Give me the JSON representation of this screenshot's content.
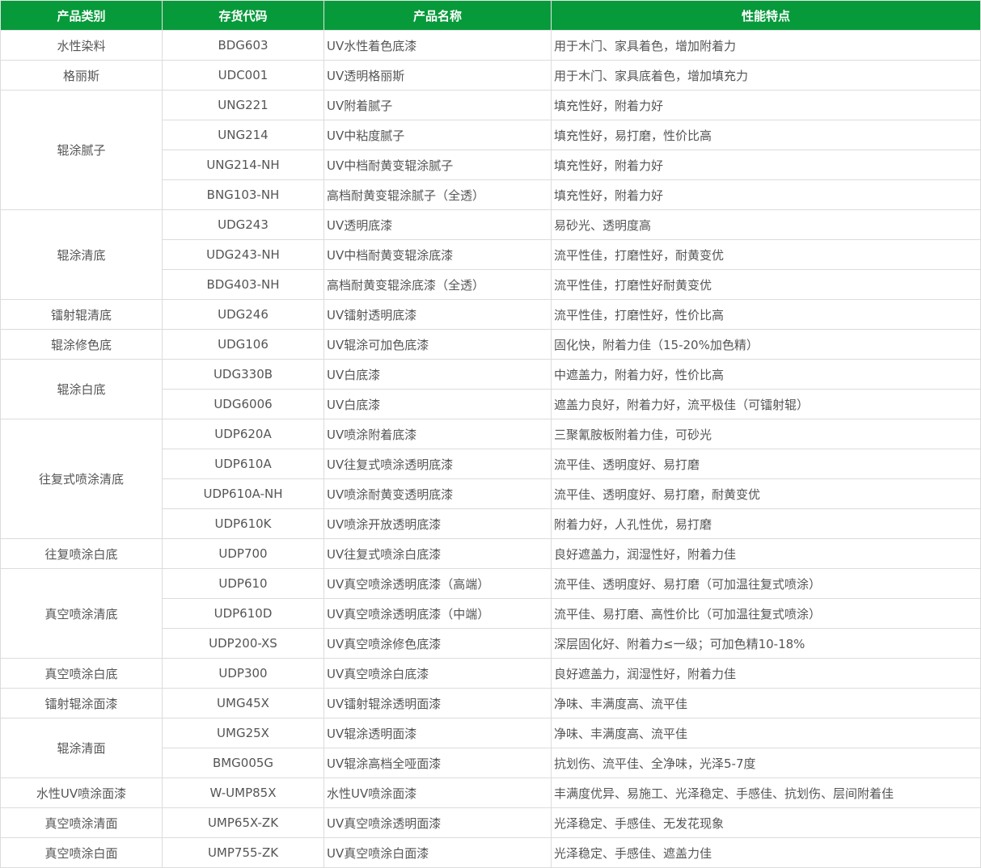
{
  "header": [
    "产品类别",
    "存货代码",
    "产品名称",
    "性能特点"
  ],
  "groups": [
    {
      "category": "水性染料",
      "items": [
        {
          "code": "BDG603",
          "name": "UV水性着色底漆",
          "feature": "用于木门、家具着色，增加附着力"
        }
      ]
    },
    {
      "category": "格丽斯",
      "items": [
        {
          "code": "UDC001",
          "name": "UV透明格丽斯",
          "feature": "用于木门、家具底着色，增加填充力"
        }
      ]
    },
    {
      "category": "辊涂腻子",
      "items": [
        {
          "code": "UNG221",
          "name": "UV附着腻子",
          "feature": "填充性好，附着力好"
        },
        {
          "code": "UNG214",
          "name": "UV中粘度腻子",
          "feature": "填充性好，易打磨，性价比高"
        },
        {
          "code": "UNG214-NH",
          "name": "UV中档耐黄变辊涂腻子",
          "feature": "填充性好，附着力好"
        },
        {
          "code": "BNG103-NH",
          "name": "高档耐黄变辊涂腻子（全透）",
          "feature": "填充性好，附着力好"
        }
      ]
    },
    {
      "category": "辊涂清底",
      "items": [
        {
          "code": "UDG243",
          "name": "UV透明底漆",
          "feature": "易砂光、透明度高"
        },
        {
          "code": "UDG243-NH",
          "name": "UV中档耐黄变辊涂底漆",
          "feature": "流平性佳，打磨性好，耐黄变优"
        },
        {
          "code": "BDG403-NH",
          "name": "高档耐黄变辊涂底漆（全透）",
          "feature": "流平性佳，打磨性好耐黄变优"
        }
      ]
    },
    {
      "category": "镭射辊清底",
      "items": [
        {
          "code": "UDG246",
          "name": "UV镭射透明底漆",
          "feature": "流平性佳，打磨性好，性价比高"
        }
      ]
    },
    {
      "category": "辊涂修色底",
      "items": [
        {
          "code": "UDG106",
          "name": "UV辊涂可加色底漆",
          "feature": "固化快，附着力佳（15-20%加色精）"
        }
      ]
    },
    {
      "category": "辊涂白底",
      "items": [
        {
          "code": "UDG330B",
          "name": "UV白底漆",
          "feature": "中遮盖力，附着力好，性价比高"
        },
        {
          "code": "UDG6006",
          "name": "UV白底漆",
          "feature": "遮盖力良好，附着力好，流平极佳（可镭射辊）"
        }
      ]
    },
    {
      "category": "往复式喷涂清底",
      "items": [
        {
          "code": "UDP620A",
          "name": "UV喷涂附着底漆",
          "feature": "三聚氰胺板附着力佳，可砂光"
        },
        {
          "code": "UDP610A",
          "name": "UV往复式喷涂透明底漆",
          "feature": "流平佳、透明度好、易打磨"
        },
        {
          "code": "UDP610A-NH",
          "name": "UV喷涂耐黄变透明底漆",
          "feature": "流平佳、透明度好、易打磨，耐黄变优"
        },
        {
          "code": "UDP610K",
          "name": "UV喷涂开放透明底漆",
          "feature": "附着力好，人孔性优，易打磨"
        }
      ]
    },
    {
      "category": "往复喷涂白底",
      "items": [
        {
          "code": "UDP700",
          "name": "UV往复式喷涂白底漆",
          "feature": "良好遮盖力，润湿性好，附着力佳"
        }
      ]
    },
    {
      "category": "真空喷涂清底",
      "items": [
        {
          "code": "UDP610",
          "name": "UV真空喷涂透明底漆（高端）",
          "feature": "流平佳、透明度好、易打磨（可加温往复式喷涂）"
        },
        {
          "code": "UDP610D",
          "name": "UV真空喷涂透明底漆（中端）",
          "feature": "流平佳、易打磨、高性价比（可加温往复式喷涂）"
        },
        {
          "code": "UDP200-XS",
          "name": "UV真空喷涂修色底漆",
          "feature": "深层固化好、附着力≤一级；可加色精10-18%"
        }
      ]
    },
    {
      "category": "真空喷涂白底",
      "items": [
        {
          "code": "UDP300",
          "name": "UV真空喷涂白底漆",
          "feature": "良好遮盖力，润湿性好，附着力佳"
        }
      ]
    },
    {
      "category": "镭射辊涂面漆",
      "items": [
        {
          "code": "UMG45X",
          "name": "UV镭射辊涂透明面漆",
          "feature": "净味、丰满度高、流平佳"
        }
      ]
    },
    {
      "category": "辊涂清面",
      "items": [
        {
          "code": "UMG25X",
          "name": "UV辊涂透明面漆",
          "feature": "净味、丰满度高、流平佳"
        },
        {
          "code": "BMG005G",
          "name": "UV辊涂高档全哑面漆",
          "feature": "抗划伤、流平佳、全净味，光泽5-7度"
        }
      ]
    },
    {
      "category": "水性UV喷涂面漆",
      "items": [
        {
          "code": "W-UMP85X",
          "name": "水性UV喷涂面漆",
          "feature": "丰满度优异、易施工、光泽稳定、手感佳、抗划伤、层间附着佳"
        }
      ]
    },
    {
      "category": "真空喷涂清面",
      "items": [
        {
          "code": "UMP65X-ZK",
          "name": "UV真空喷涂透明面漆",
          "feature": "光泽稳定、手感佳、无发花现象"
        }
      ]
    },
    {
      "category": "真空喷涂白面",
      "items": [
        {
          "code": "UMP755-ZK",
          "name": "UV真空喷涂白面漆",
          "feature": "光泽稳定、手感佳、遮盖力佳"
        }
      ]
    }
  ]
}
